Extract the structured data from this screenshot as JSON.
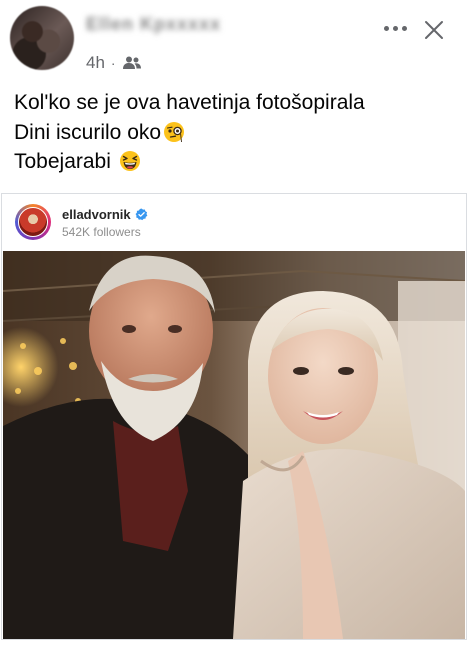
{
  "post": {
    "author_name": "Ellen Kpxxxxx",
    "time": "4h",
    "separator": "·",
    "audience_icon": "friends-icon",
    "text_lines": [
      "Kol'ko se je ova havetinja fotošopirala",
      "Dini iscurilo oko",
      "Tobejarabi"
    ],
    "emojis": [
      "monocle-face-emoji",
      "laughing-squinting-emoji"
    ]
  },
  "embed": {
    "username": "elladvornik",
    "followers": "542K followers",
    "verified_color": "#3897f0",
    "photo_description_icon": "selfie-photo"
  },
  "colors": {
    "secondary_text": "#65676b",
    "primary_text": "#050505"
  }
}
